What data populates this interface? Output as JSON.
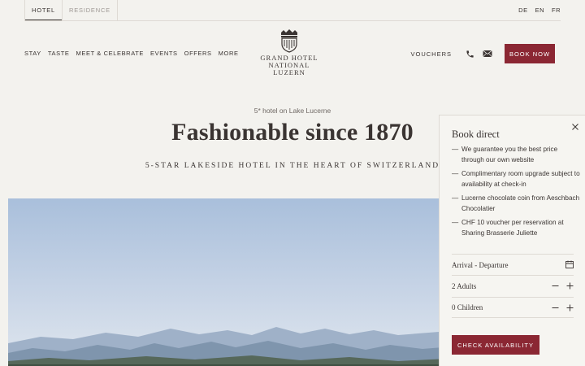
{
  "top_tabs": [
    {
      "label": "HOTEL",
      "active": true
    },
    {
      "label": "RESIDENCE",
      "active": false
    }
  ],
  "languages": [
    "DE",
    "EN",
    "FR"
  ],
  "main_nav": [
    "STAY",
    "TASTE",
    "MEET & CELEBRATE",
    "EVENTS",
    "OFFERS",
    "MORE"
  ],
  "logo": {
    "line1": "GRAND HOTEL",
    "line2": "NATIONAL",
    "line3": "LUZERN"
  },
  "right_nav": {
    "vouchers": "VOUCHERS",
    "phone_icon": "phone-icon",
    "mail_icon": "mail-icon",
    "book_now": "BOOK NOW"
  },
  "hero": {
    "subtitle": "5* hotel on Lake Lucerne",
    "title": "Fashionable since 1870",
    "tagline": "5-STAR LAKESIDE HOTEL IN THE HEART OF SWITZERLAND"
  },
  "booking_panel": {
    "title": "Book direct",
    "benefits": [
      "We guarantee you the best price through our own website",
      "Complimentary room upgrade subject to availability at check-in",
      "Lucerne chocolate coin from Aeschbach Chocolatier",
      "CHF 10 voucher per reservation at Sharing Brasserie Juliette"
    ],
    "dates_label": "Arrival - Departure",
    "adults_label": "2 Adults",
    "children_label": "0 Children",
    "check_button": "CHECK AVAILABILITY"
  },
  "colors": {
    "accent": "#8b2733",
    "background": "#f3f2ee",
    "text": "#3a3432"
  }
}
